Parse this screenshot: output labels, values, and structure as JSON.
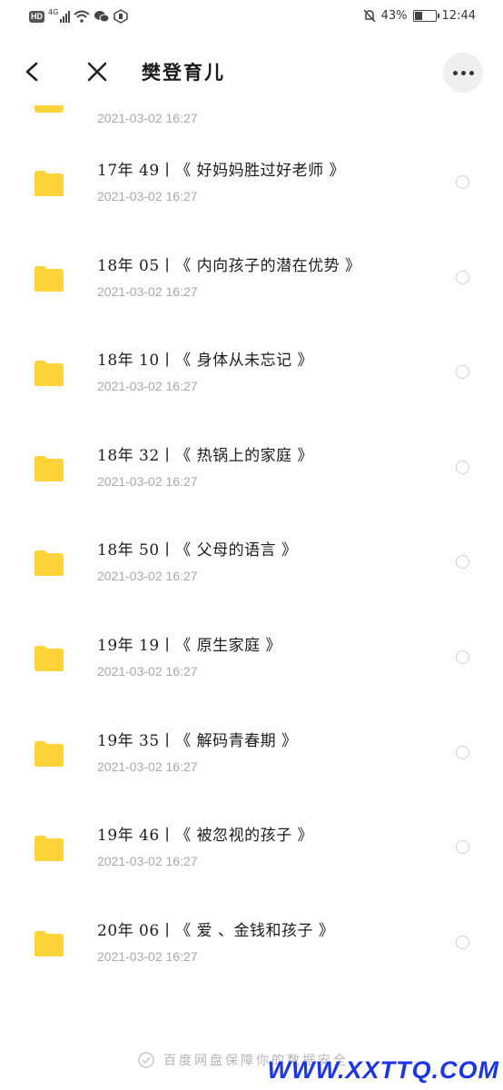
{
  "status_bar": {
    "network": "4G",
    "battery_text": "43%",
    "battery_level": 0.43,
    "time": "12:44",
    "icons": [
      "hd-icon",
      "signal-icon",
      "wifi-icon",
      "wechat-icon",
      "hand-icon",
      "mute-icon",
      "battery-icon"
    ]
  },
  "header": {
    "title": "樊登育儿",
    "back_icon": "chevron-left-icon",
    "close_icon": "close-icon",
    "more_icon": "more-horizontal-icon"
  },
  "list": {
    "partial_item": {
      "date": "2021-03-02 16:27"
    },
    "items": [
      {
        "name": "17年 49丨《 好妈妈胜过好老师 》",
        "date": "2021-03-02 16:27"
      },
      {
        "name": "18年 05丨《 内向孩子的潜在优势 》",
        "date": "2021-03-02 16:27"
      },
      {
        "name": "18年 10丨《 身体从未忘记 》",
        "date": "2021-03-02 16:27"
      },
      {
        "name": "18年 32丨《 热锅上的家庭 》",
        "date": "2021-03-02 16:27"
      },
      {
        "name": "18年 50丨《 父母的语言 》",
        "date": "2021-03-02 16:27"
      },
      {
        "name": "19年 19丨《 原生家庭 》",
        "date": "2021-03-02 16:27"
      },
      {
        "name": "19年 35丨《 解码青春期 》",
        "date": "2021-03-02 16:27"
      },
      {
        "name": "19年 46丨《 被忽视的孩子 》",
        "date": "2021-03-02 16:27"
      },
      {
        "name": "20年 06丨《 爱 、金钱和孩子 》",
        "date": "2021-03-02 16:27"
      }
    ]
  },
  "footer": {
    "text": "百度网盘保障你的数据安全",
    "watermark": "WWW.XXTTQ.COM"
  },
  "colors": {
    "folder": "#ffd43b",
    "watermark": "#1c35e6"
  }
}
